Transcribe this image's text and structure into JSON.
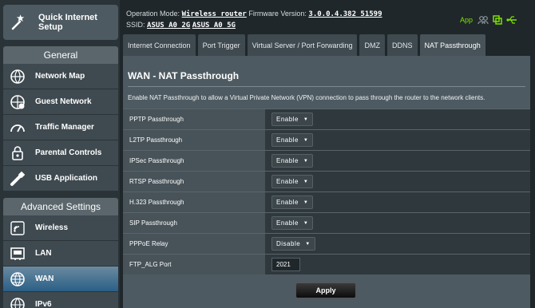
{
  "sidebar": {
    "quick_setup": "Quick Internet\nSetup",
    "general_header": "General",
    "general_items": [
      {
        "label": "Network Map",
        "icon": "network-map-icon"
      },
      {
        "label": "Guest Network",
        "icon": "guest-network-icon"
      },
      {
        "label": "Traffic Manager",
        "icon": "traffic-manager-icon"
      },
      {
        "label": "Parental Controls",
        "icon": "parental-controls-icon"
      },
      {
        "label": "USB Application",
        "icon": "usb-application-icon"
      }
    ],
    "advanced_header": "Advanced Settings",
    "advanced_items": [
      {
        "label": "Wireless",
        "icon": "wireless-icon"
      },
      {
        "label": "LAN",
        "icon": "lan-icon"
      },
      {
        "label": "WAN",
        "icon": "wan-icon",
        "active": true
      },
      {
        "label": "IPv6",
        "icon": "ipv6-icon"
      }
    ]
  },
  "topbar": {
    "op_mode_label": "Operation Mode:",
    "op_mode_value": "Wireless router",
    "fw_label": "Firmware Version:",
    "fw_value": "3.0.0.4.382_51599",
    "ssid_label": "SSID:",
    "ssid_1": "ASUS_A0_2G",
    "ssid_2": "ASUS_A0_5G",
    "app_label": "App",
    "accent": "#7fe000"
  },
  "tabs": [
    {
      "label": "Internet Connection"
    },
    {
      "label": "Port Trigger"
    },
    {
      "label": "Virtual Server / Port Forwarding"
    },
    {
      "label": "DMZ"
    },
    {
      "label": "DDNS"
    },
    {
      "label": "NAT Passthrough",
      "active": true
    }
  ],
  "main": {
    "title": "WAN - NAT Passthrough",
    "description": "Enable NAT Passthrough to allow a Virtual Private Network (VPN) connection to pass through the router to the network clients.",
    "rows": [
      {
        "label": "PPTP Passthrough",
        "value": "Enable",
        "type": "select"
      },
      {
        "label": "L2TP Passthrough",
        "value": "Enable",
        "type": "select"
      },
      {
        "label": "IPSec Passthrough",
        "value": "Enable",
        "type": "select"
      },
      {
        "label": "RTSP Passthrough",
        "value": "Enable",
        "type": "select"
      },
      {
        "label": "H.323 Passthrough",
        "value": "Enable",
        "type": "select"
      },
      {
        "label": "SIP Passthrough",
        "value": "Enable",
        "type": "select"
      },
      {
        "label": "PPPoE Relay",
        "value": "Disable",
        "type": "select"
      },
      {
        "label": "FTP_ALG Port",
        "value": "2021",
        "type": "input"
      }
    ],
    "apply_label": "Apply"
  }
}
